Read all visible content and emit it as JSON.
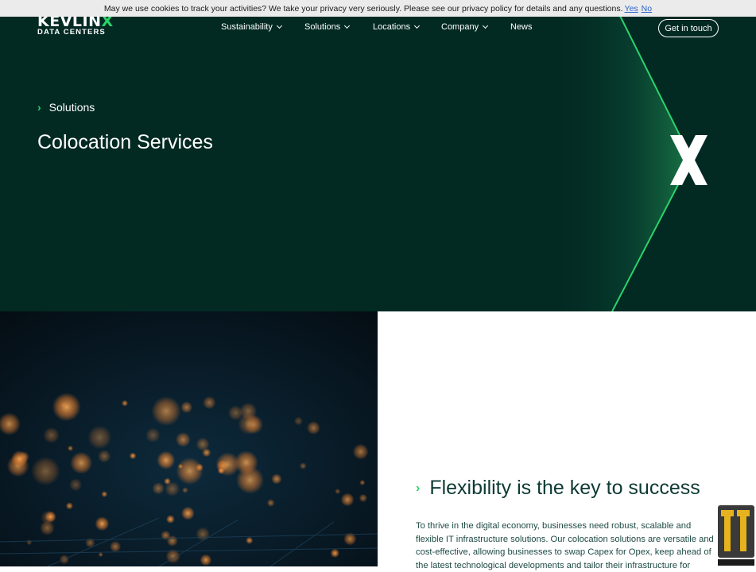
{
  "cookie": {
    "message": "May we use cookies to track your activities? We take your privacy very seriously. Please see our privacy policy for details and any questions.",
    "yes": "Yes",
    "no": "No"
  },
  "brand": {
    "name_main": "KEVLIN",
    "name_x": "X",
    "tagline": "DATA CENTERS",
    "accent": "#2ad36a",
    "bg": "#022a23"
  },
  "nav": {
    "items": [
      {
        "label": "Sustainability",
        "dropdown": true
      },
      {
        "label": "Solutions",
        "dropdown": true
      },
      {
        "label": "Locations",
        "dropdown": true
      },
      {
        "label": "Company",
        "dropdown": true
      },
      {
        "label": "News",
        "dropdown": false
      }
    ],
    "cta": "Get in touch"
  },
  "hero": {
    "breadcrumb": "Solutions",
    "title": "Colocation Services"
  },
  "section": {
    "title": "Flexibility is the key to success",
    "body": "To thrive in the digital economy, businesses need robust, scalable and flexible IT infrastructure solutions. Our colocation solutions are versatile and cost-effective, allowing businesses to swap Capex for Opex, keep ahead of the latest technological developments and tailor their infrastructure for"
  },
  "icons": [
    "chevron-down-icon",
    "chevron-right-icon",
    "x-mark-logo",
    "watermark-badge"
  ]
}
